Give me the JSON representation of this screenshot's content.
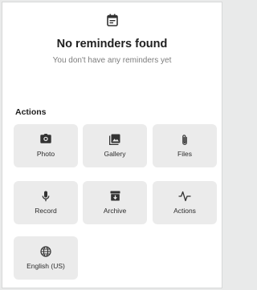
{
  "empty_state": {
    "icon": "calendar-icon",
    "title": "No reminders found",
    "subtitle": "You don't have any reminders yet"
  },
  "actions": {
    "title": "Actions",
    "items": [
      {
        "label": "Photo",
        "icon": "camera-icon"
      },
      {
        "label": "Gallery",
        "icon": "image-icon"
      },
      {
        "label": "Files",
        "icon": "paperclip-icon"
      },
      {
        "label": "Record",
        "icon": "microphone-icon"
      },
      {
        "label": "Archive",
        "icon": "archive-icon"
      },
      {
        "label": "Actions",
        "icon": "pulse-icon"
      },
      {
        "label": "English (US)",
        "icon": "globe-icon"
      }
    ]
  },
  "colors": {
    "tile_background": "#ebebeb",
    "text_primary": "#1f1f1f",
    "text_secondary": "#7d7d7d"
  }
}
